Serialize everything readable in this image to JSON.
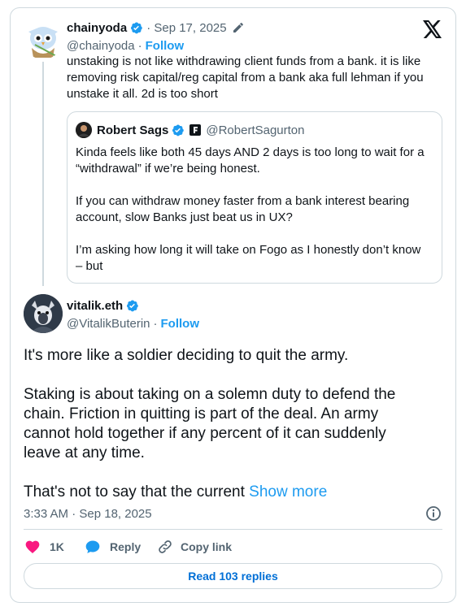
{
  "parent": {
    "name": "chainyoda",
    "date": "· Sep 17, 2025",
    "handle": "@chainyoda",
    "follow_sep": "·",
    "follow": "Follow",
    "text_lines": [
      "unstaking is not like withdrawing client funds from a bank. it is like",
      "removing risk capital/reg capital from a bank aka full lehman if you",
      "unstake it all. 2d is too short"
    ]
  },
  "quote": {
    "name": "Robert Sags",
    "handle": "@RobertSagurton",
    "p1_lines": [
      "Kinda feels like both 45 days AND 2 days is too long to wait for a",
      "“withdrawal” if we’re being honest."
    ],
    "p2_lines": [
      "If you can withdraw money faster from a bank interest bearing",
      "account, slow Banks just beat us in UX?"
    ],
    "p3_lines": [
      "I’m asking how long it will take on Fogo as I honestly don’t know",
      "– but"
    ]
  },
  "main": {
    "name": "vitalik.eth",
    "handle": "@VitalikButerin",
    "follow_sep": "·",
    "follow": "Follow",
    "p1": "It's more like a soldier deciding to quit the army.",
    "p2_lines": [
      "Staking is about taking on a solemn duty to defend the",
      "chain. Friction in quitting is part of the deal. An army",
      "cannot hold together if any percent of it can suddenly",
      "leave at any time."
    ],
    "p3": "That's not to say that the current ",
    "show_more": "Show more",
    "timestamp": "3:33 AM · Sep 18, 2025"
  },
  "actions": {
    "likes": "1K",
    "reply": "Reply",
    "copy_link": "Copy link",
    "read_replies": "Read 103 replies"
  },
  "colors": {
    "accent": "#1d9bf0",
    "like": "#f91880",
    "text": "#0f1419",
    "muted": "#536471",
    "border": "#cfd9de"
  }
}
